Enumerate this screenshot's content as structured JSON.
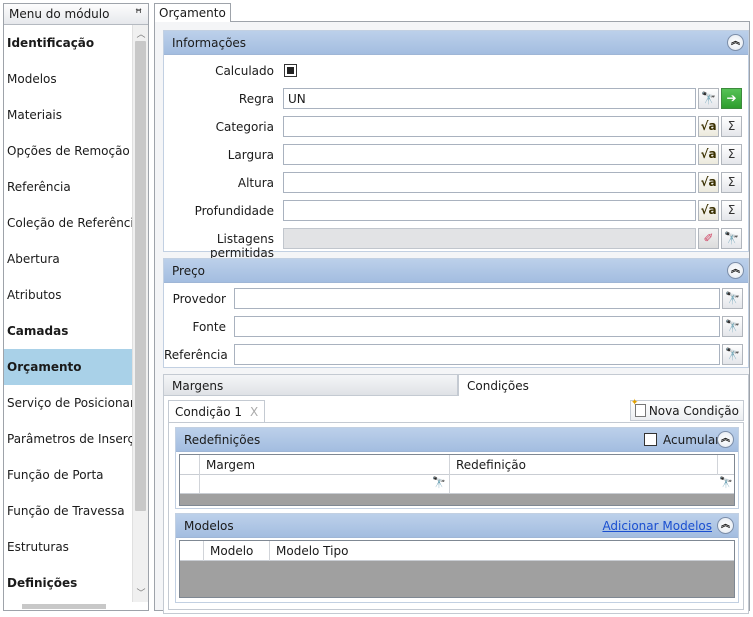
{
  "sidebar": {
    "title": "Menu do módulo",
    "items": [
      {
        "label": "Identificação",
        "bold": true,
        "selected": false
      },
      {
        "label": "Modelos",
        "bold": false,
        "selected": false
      },
      {
        "label": "Materiais",
        "bold": false,
        "selected": false
      },
      {
        "label": "Opções de Remoção",
        "bold": false,
        "selected": false
      },
      {
        "label": "Referência",
        "bold": false,
        "selected": false
      },
      {
        "label": "Coleção de Referências",
        "bold": false,
        "selected": false
      },
      {
        "label": "Abertura",
        "bold": false,
        "selected": false
      },
      {
        "label": "Atributos",
        "bold": false,
        "selected": false
      },
      {
        "label": "Camadas",
        "bold": true,
        "selected": false
      },
      {
        "label": "Orçamento",
        "bold": true,
        "selected": true
      },
      {
        "label": "Serviço de Posicionamento",
        "bold": false,
        "selected": false
      },
      {
        "label": "Parâmetros de Inserção",
        "bold": false,
        "selected": false
      },
      {
        "label": "Função de Porta",
        "bold": false,
        "selected": false
      },
      {
        "label": "Função de Travessa",
        "bold": false,
        "selected": false
      },
      {
        "label": "Estruturas",
        "bold": false,
        "selected": false
      },
      {
        "label": "Definições",
        "bold": true,
        "selected": false
      }
    ]
  },
  "document_tab": "Orçamento",
  "informacoes": {
    "title": "Informações",
    "calculado_label": "Calculado",
    "calculado_checked": true,
    "regra_label": "Regra",
    "regra_value": "UN",
    "categoria_label": "Categoria",
    "categoria_value": "",
    "largura_label": "Largura",
    "largura_value": "",
    "altura_label": "Altura",
    "altura_value": "",
    "profundidade_label": "Profundidade",
    "profundidade_value": "",
    "listagens_label": "Listagens permitidas",
    "listagens_value": ""
  },
  "preco": {
    "title": "Preço",
    "provedor_label": "Provedor",
    "provedor_value": "",
    "fonte_label": "Fonte",
    "fonte_value": "",
    "referencia_label": "Referência",
    "referencia_value": ""
  },
  "tabs": {
    "margens": "Margens",
    "condicoes": "Condições"
  },
  "condicao": {
    "tab_label": "Condição 1",
    "close_glyph": "X",
    "nova_label": "Nova Condição",
    "redefinicoes": {
      "title": "Redefinições",
      "acumular_label": "Acumular",
      "acumular_checked": false,
      "columns": [
        "Margem",
        "Redefinição"
      ]
    },
    "modelos": {
      "title": "Modelos",
      "add_link": "Adicionar Modelos",
      "columns": [
        "Modelo",
        "Modelo Tipo"
      ]
    }
  },
  "icons": {
    "binoculars": "binoculars-icon",
    "arrow": "go-arrow-icon",
    "formula": "formula-icon",
    "sum": "sum-icon",
    "eraser": "eraser-icon",
    "pin": "pin-icon",
    "collapse": "collapse-icon"
  }
}
